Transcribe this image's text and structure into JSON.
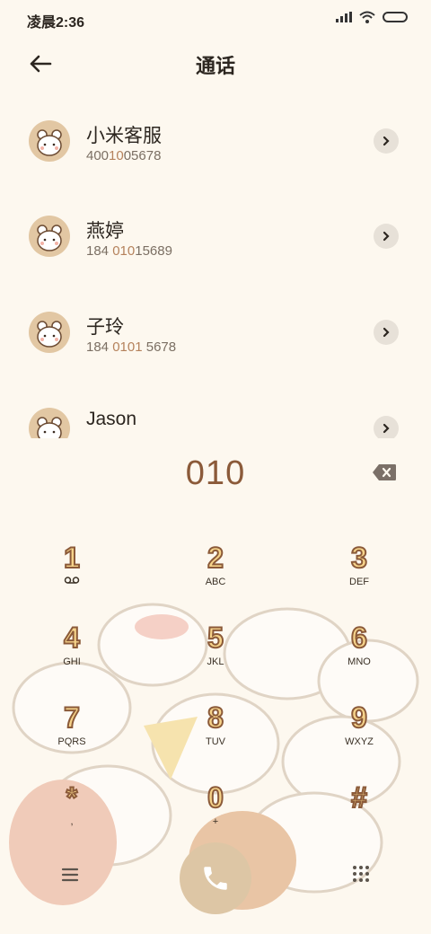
{
  "status_bar": {
    "time": "凌晨2:36",
    "icons": [
      "signal-icon",
      "wifi-icon",
      "battery-icon"
    ]
  },
  "header": {
    "title": "通话",
    "back_icon": "arrow-left-icon"
  },
  "contacts": [
    {
      "name": "小米客服",
      "number_pre": "400",
      "number_hl": "10",
      "number_post": "05678"
    },
    {
      "name": "燕婷",
      "number_pre": "184 ",
      "number_hl": "010",
      "number_post": "15689"
    },
    {
      "name": "子玲",
      "number_pre": "184 ",
      "number_hl": "0101",
      "number_post": " 5678"
    },
    {
      "name": "Jason",
      "number_pre": "",
      "number_hl": "",
      "number_post": ""
    }
  ],
  "dialer": {
    "dialed_number": "010",
    "keys": [
      {
        "digit": "1",
        "letters": ""
      },
      {
        "digit": "2",
        "letters": "ABC"
      },
      {
        "digit": "3",
        "letters": "DEF"
      },
      {
        "digit": "4",
        "letters": "GHI"
      },
      {
        "digit": "5",
        "letters": "JKL"
      },
      {
        "digit": "6",
        "letters": "MNO"
      },
      {
        "digit": "7",
        "letters": "PQRS"
      },
      {
        "digit": "8",
        "letters": "TUV"
      },
      {
        "digit": "9",
        "letters": "WXYZ"
      },
      {
        "digit": "*",
        "letters": ","
      },
      {
        "digit": "0",
        "letters": "+"
      },
      {
        "digit": "#",
        "letters": ""
      }
    ]
  },
  "colors": {
    "background": "#fdf8ef",
    "accent": "#8b5a39",
    "key_fill": "#f6d38a",
    "call_button": "#ddc6a5"
  }
}
